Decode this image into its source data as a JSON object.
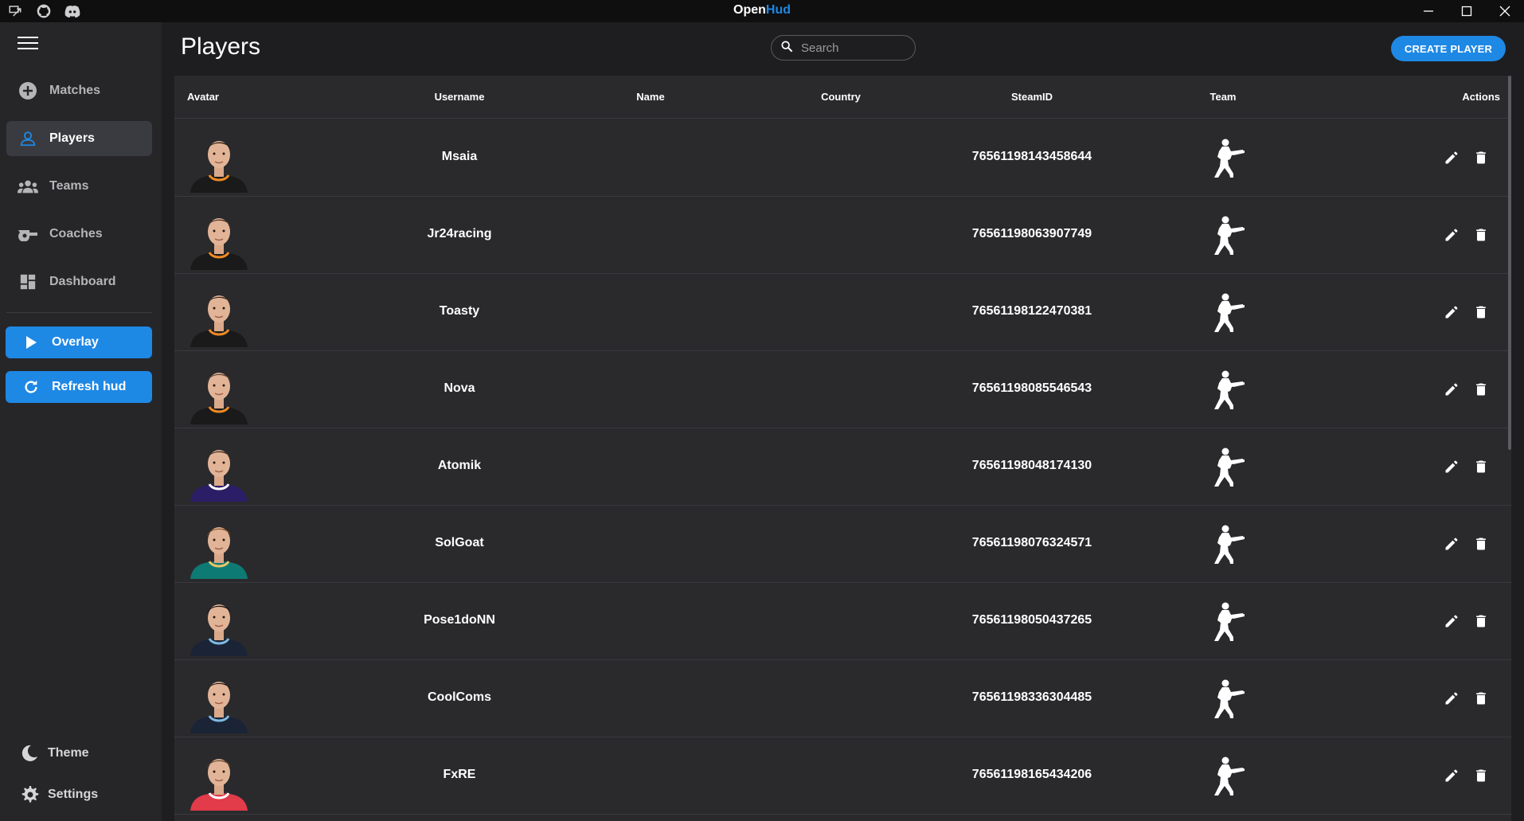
{
  "app": {
    "title_part1": "Open",
    "title_part2": "Hud"
  },
  "titlebar": {
    "icons": [
      "remote-icon",
      "github-icon",
      "discord-icon"
    ],
    "controls": [
      "minimize-icon",
      "maximize-icon",
      "close-icon"
    ]
  },
  "sidebar": {
    "menu_icon": "hamburger-icon",
    "items": [
      {
        "label": "Matches",
        "icon": "add-circle-icon",
        "active": false
      },
      {
        "label": "Players",
        "icon": "person-icon",
        "active": true
      },
      {
        "label": "Teams",
        "icon": "group-icon",
        "active": false
      },
      {
        "label": "Coaches",
        "icon": "whistle-icon",
        "active": false
      },
      {
        "label": "Dashboard",
        "icon": "dashboard-icon",
        "active": false
      }
    ],
    "overlay_label": "Overlay",
    "refresh_label": "Refresh hud",
    "theme_label": "Theme",
    "settings_label": "Settings"
  },
  "page": {
    "title": "Players"
  },
  "search": {
    "placeholder": "Search",
    "value": ""
  },
  "create_button": "CREATE PLAYER",
  "table": {
    "columns": [
      "Avatar",
      "Username",
      "Name",
      "Country",
      "SteamID",
      "Team",
      "Actions"
    ],
    "rows": [
      {
        "username": "Msaia",
        "name": "",
        "country": "",
        "steamid": "76561198143458644",
        "shirt": "#1a1a1a",
        "trim": "#f08a24",
        "hair": "#2a1a12"
      },
      {
        "username": "Jr24racing",
        "name": "",
        "country": "",
        "steamid": "76561198063907749",
        "shirt": "#1a1a1a",
        "trim": "#f08a24",
        "hair": "#4a3324"
      },
      {
        "username": "Toasty",
        "name": "",
        "country": "",
        "steamid": "76561198122470381",
        "shirt": "#1a1a1a",
        "trim": "#f08a24",
        "hair": "#3a2a1e"
      },
      {
        "username": "Nova",
        "name": "",
        "country": "",
        "steamid": "76561198085546543",
        "shirt": "#1a1a1a",
        "trim": "#f08a24",
        "hair": "#5a4030"
      },
      {
        "username": "Atomik",
        "name": "",
        "country": "",
        "steamid": "76561198048174130",
        "shirt": "#2b1d66",
        "trim": "#ffffff",
        "hair": "#3a2a20"
      },
      {
        "username": "SolGoat",
        "name": "",
        "country": "",
        "steamid": "76561198076324571",
        "shirt": "#0e7a74",
        "trim": "#e9c46a",
        "hair": "#8a5a2a"
      },
      {
        "username": "Pose1doNN",
        "name": "",
        "country": "",
        "steamid": "76561198050437265",
        "shirt": "#1a2436",
        "trim": "#7fb8e0",
        "hair": "#1a1210"
      },
      {
        "username": "CoolComs",
        "name": "",
        "country": "",
        "steamid": "76561198336304485",
        "shirt": "#1a2436",
        "trim": "#7fb8e0",
        "hair": "#2a1e18"
      },
      {
        "username": "FxRE",
        "name": "",
        "country": "",
        "steamid": "76561198165434206",
        "shirt": "#e23b4a",
        "trim": "#ffffff",
        "hair": "#6a4a30"
      }
    ],
    "team_icon": "counter-terrorist-icon",
    "action_icons": [
      "edit-icon",
      "delete-icon"
    ]
  }
}
